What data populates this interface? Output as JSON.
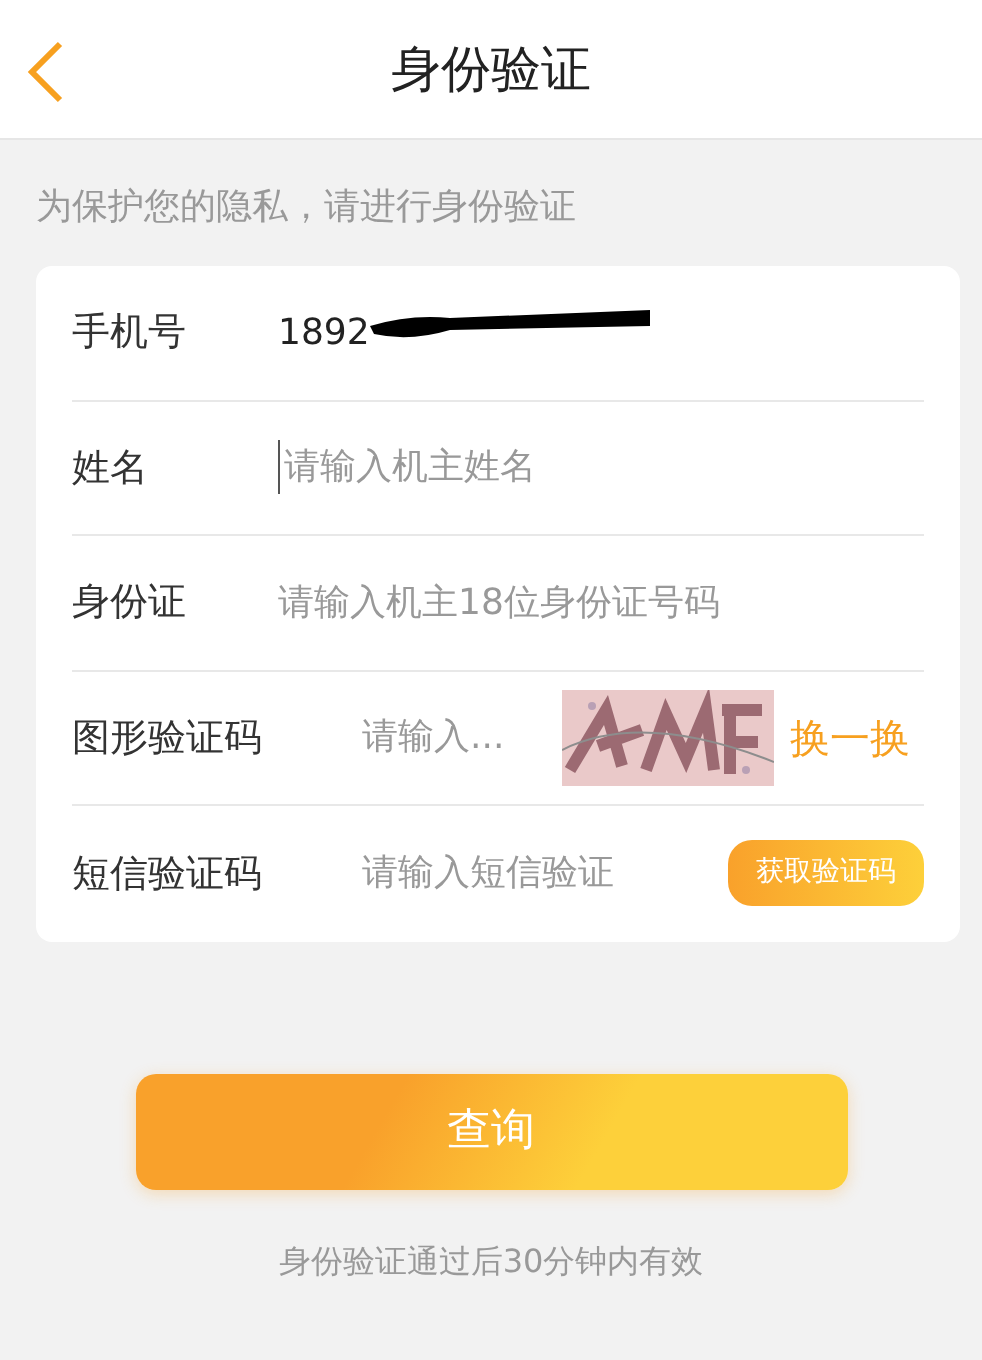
{
  "header": {
    "title": "身份验证"
  },
  "notice": "为保护您的隐私，请进行身份验证",
  "form_rows": [
    {
      "kind": "value",
      "label": "手机号",
      "value": "1892",
      "redacted": true
    },
    {
      "kind": "input",
      "label": "姓名",
      "placeholder": "请输入机主姓名",
      "focused": true
    },
    {
      "kind": "input",
      "label": "身份证",
      "placeholder": "请输入机主18位身份证号码",
      "focused": false
    },
    {
      "kind": "captcha",
      "label": "图形验证码",
      "placeholder": "请输入...",
      "action": "换一换"
    },
    {
      "kind": "sms",
      "label": "短信验证码",
      "placeholder": "请输入短信验证",
      "action": "获取验证码"
    }
  ],
  "submit_button": "查询",
  "footer_note": "身份验证通过后30分钟内有效"
}
